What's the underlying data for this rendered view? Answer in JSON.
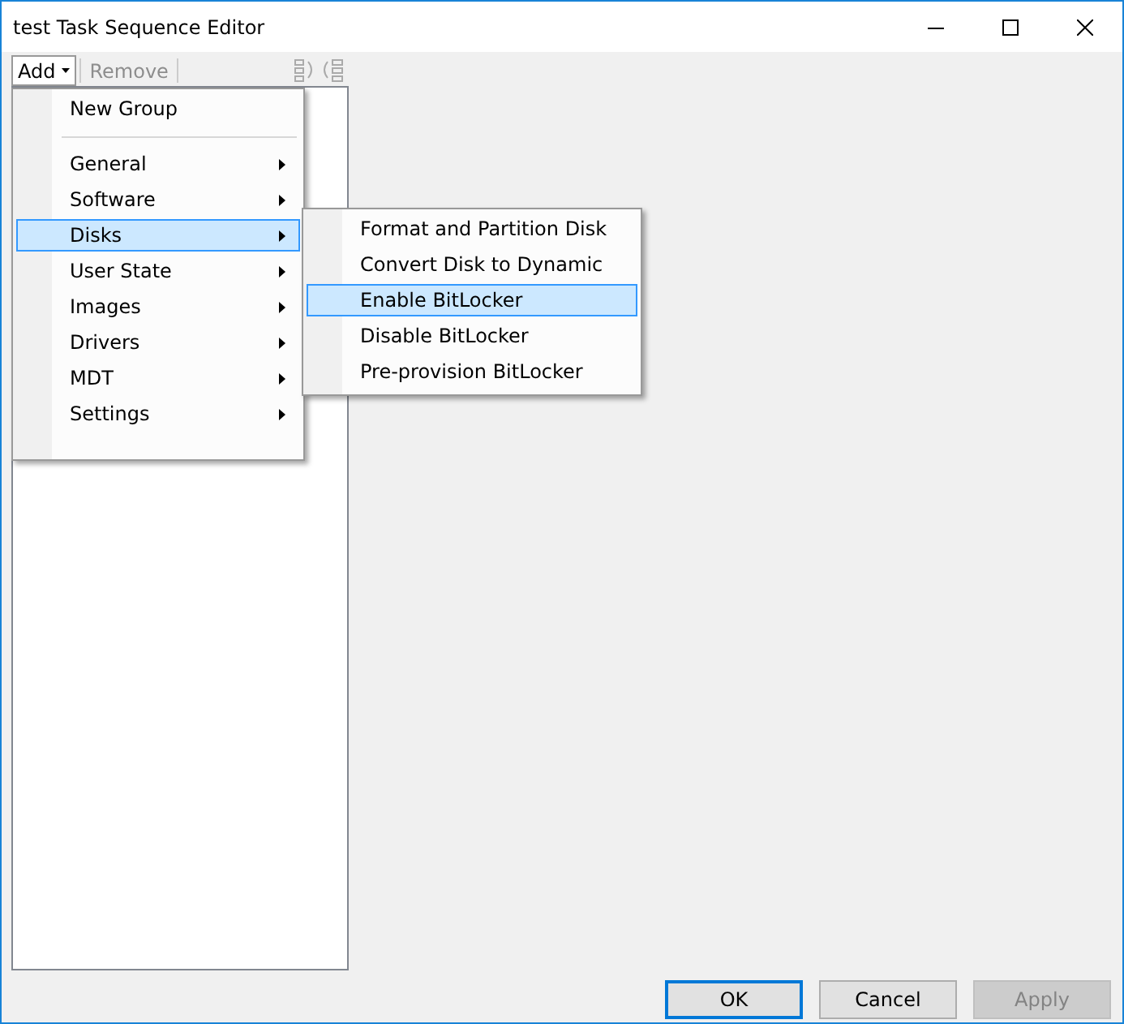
{
  "window": {
    "title": "test Task Sequence Editor"
  },
  "toolbar": [
    {
      "label": "Add",
      "kind": "dropdown",
      "disabled": false
    },
    {
      "label": "Remove",
      "kind": "button",
      "disabled": true
    }
  ],
  "menu": [
    {
      "label": "New Group",
      "kind": "item",
      "has_submenu": false,
      "selected": false
    },
    {
      "kind": "separator"
    },
    {
      "label": "General",
      "kind": "item",
      "has_submenu": true,
      "selected": false
    },
    {
      "label": "Software",
      "kind": "item",
      "has_submenu": true,
      "selected": false
    },
    {
      "label": "Disks",
      "kind": "item",
      "has_submenu": true,
      "selected": true
    },
    {
      "label": "User State",
      "kind": "item",
      "has_submenu": true,
      "selected": false
    },
    {
      "label": "Images",
      "kind": "item",
      "has_submenu": true,
      "selected": false
    },
    {
      "label": "Drivers",
      "kind": "item",
      "has_submenu": true,
      "selected": false
    },
    {
      "label": "MDT",
      "kind": "item",
      "has_submenu": true,
      "selected": false
    },
    {
      "label": "Settings",
      "kind": "item",
      "has_submenu": true,
      "selected": false
    }
  ],
  "submenu": [
    {
      "label": "Format and Partition Disk",
      "selected": false
    },
    {
      "label": "Convert Disk to Dynamic",
      "selected": false
    },
    {
      "label": "Enable BitLocker",
      "selected": true
    },
    {
      "label": "Disable BitLocker",
      "selected": false
    },
    {
      "label": "Pre-provision BitLocker",
      "selected": false
    }
  ],
  "buttons": [
    {
      "label": "OK",
      "default": true,
      "disabled": false
    },
    {
      "label": "Cancel",
      "default": false,
      "disabled": false
    },
    {
      "label": "Apply",
      "default": false,
      "disabled": true
    }
  ]
}
